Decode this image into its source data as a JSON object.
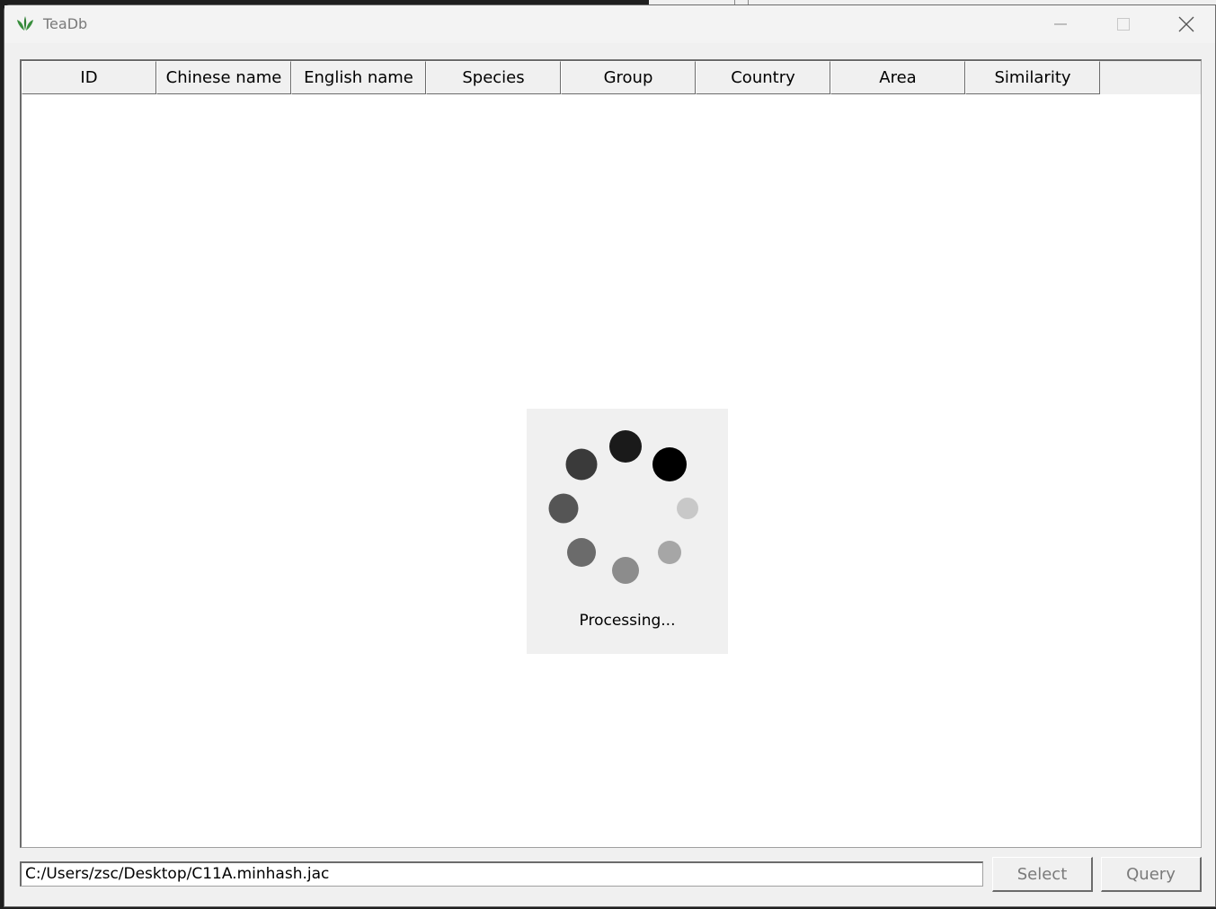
{
  "window": {
    "title": "TeaDb"
  },
  "table": {
    "columns": [
      "ID",
      "Chinese name",
      "English name",
      "Species",
      "Group",
      "Country",
      "Area",
      "Similarity"
    ]
  },
  "spinner": {
    "status_text": "Processing..."
  },
  "footer": {
    "path_value": "C:/Users/zsc/Desktop/C11A.minhash.jac",
    "select_label": "Select",
    "query_label": "Query"
  },
  "colors": {
    "window_bg": "#f0f0f0",
    "table_bg": "#ffffff",
    "disabled_text": "#7a7a7a",
    "icon_green": "#2e7d32"
  }
}
